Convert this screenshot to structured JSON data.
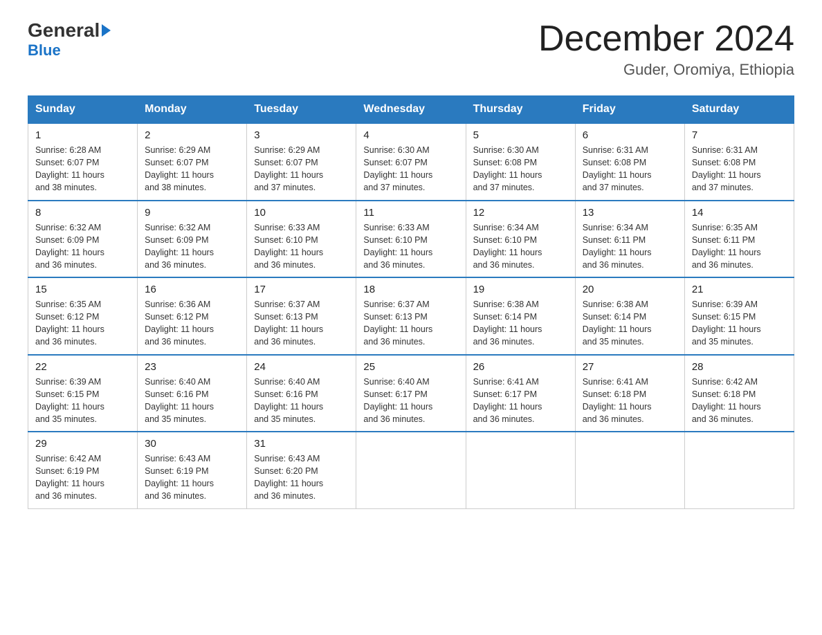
{
  "header": {
    "logo_general": "General",
    "logo_blue": "Blue",
    "month_title": "December 2024",
    "location": "Guder, Oromiya, Ethiopia"
  },
  "days_of_week": [
    "Sunday",
    "Monday",
    "Tuesday",
    "Wednesday",
    "Thursday",
    "Friday",
    "Saturday"
  ],
  "weeks": [
    [
      {
        "day": "1",
        "sunrise": "6:28 AM",
        "sunset": "6:07 PM",
        "daylight": "11 hours and 38 minutes."
      },
      {
        "day": "2",
        "sunrise": "6:29 AM",
        "sunset": "6:07 PM",
        "daylight": "11 hours and 38 minutes."
      },
      {
        "day": "3",
        "sunrise": "6:29 AM",
        "sunset": "6:07 PM",
        "daylight": "11 hours and 37 minutes."
      },
      {
        "day": "4",
        "sunrise": "6:30 AM",
        "sunset": "6:07 PM",
        "daylight": "11 hours and 37 minutes."
      },
      {
        "day": "5",
        "sunrise": "6:30 AM",
        "sunset": "6:08 PM",
        "daylight": "11 hours and 37 minutes."
      },
      {
        "day": "6",
        "sunrise": "6:31 AM",
        "sunset": "6:08 PM",
        "daylight": "11 hours and 37 minutes."
      },
      {
        "day": "7",
        "sunrise": "6:31 AM",
        "sunset": "6:08 PM",
        "daylight": "11 hours and 37 minutes."
      }
    ],
    [
      {
        "day": "8",
        "sunrise": "6:32 AM",
        "sunset": "6:09 PM",
        "daylight": "11 hours and 36 minutes."
      },
      {
        "day": "9",
        "sunrise": "6:32 AM",
        "sunset": "6:09 PM",
        "daylight": "11 hours and 36 minutes."
      },
      {
        "day": "10",
        "sunrise": "6:33 AM",
        "sunset": "6:10 PM",
        "daylight": "11 hours and 36 minutes."
      },
      {
        "day": "11",
        "sunrise": "6:33 AM",
        "sunset": "6:10 PM",
        "daylight": "11 hours and 36 minutes."
      },
      {
        "day": "12",
        "sunrise": "6:34 AM",
        "sunset": "6:10 PM",
        "daylight": "11 hours and 36 minutes."
      },
      {
        "day": "13",
        "sunrise": "6:34 AM",
        "sunset": "6:11 PM",
        "daylight": "11 hours and 36 minutes."
      },
      {
        "day": "14",
        "sunrise": "6:35 AM",
        "sunset": "6:11 PM",
        "daylight": "11 hours and 36 minutes."
      }
    ],
    [
      {
        "day": "15",
        "sunrise": "6:35 AM",
        "sunset": "6:12 PM",
        "daylight": "11 hours and 36 minutes."
      },
      {
        "day": "16",
        "sunrise": "6:36 AM",
        "sunset": "6:12 PM",
        "daylight": "11 hours and 36 minutes."
      },
      {
        "day": "17",
        "sunrise": "6:37 AM",
        "sunset": "6:13 PM",
        "daylight": "11 hours and 36 minutes."
      },
      {
        "day": "18",
        "sunrise": "6:37 AM",
        "sunset": "6:13 PM",
        "daylight": "11 hours and 36 minutes."
      },
      {
        "day": "19",
        "sunrise": "6:38 AM",
        "sunset": "6:14 PM",
        "daylight": "11 hours and 36 minutes."
      },
      {
        "day": "20",
        "sunrise": "6:38 AM",
        "sunset": "6:14 PM",
        "daylight": "11 hours and 35 minutes."
      },
      {
        "day": "21",
        "sunrise": "6:39 AM",
        "sunset": "6:15 PM",
        "daylight": "11 hours and 35 minutes."
      }
    ],
    [
      {
        "day": "22",
        "sunrise": "6:39 AM",
        "sunset": "6:15 PM",
        "daylight": "11 hours and 35 minutes."
      },
      {
        "day": "23",
        "sunrise": "6:40 AM",
        "sunset": "6:16 PM",
        "daylight": "11 hours and 35 minutes."
      },
      {
        "day": "24",
        "sunrise": "6:40 AM",
        "sunset": "6:16 PM",
        "daylight": "11 hours and 35 minutes."
      },
      {
        "day": "25",
        "sunrise": "6:40 AM",
        "sunset": "6:17 PM",
        "daylight": "11 hours and 36 minutes."
      },
      {
        "day": "26",
        "sunrise": "6:41 AM",
        "sunset": "6:17 PM",
        "daylight": "11 hours and 36 minutes."
      },
      {
        "day": "27",
        "sunrise": "6:41 AM",
        "sunset": "6:18 PM",
        "daylight": "11 hours and 36 minutes."
      },
      {
        "day": "28",
        "sunrise": "6:42 AM",
        "sunset": "6:18 PM",
        "daylight": "11 hours and 36 minutes."
      }
    ],
    [
      {
        "day": "29",
        "sunrise": "6:42 AM",
        "sunset": "6:19 PM",
        "daylight": "11 hours and 36 minutes."
      },
      {
        "day": "30",
        "sunrise": "6:43 AM",
        "sunset": "6:19 PM",
        "daylight": "11 hours and 36 minutes."
      },
      {
        "day": "31",
        "sunrise": "6:43 AM",
        "sunset": "6:20 PM",
        "daylight": "11 hours and 36 minutes."
      },
      null,
      null,
      null,
      null
    ]
  ],
  "labels": {
    "sunrise": "Sunrise:",
    "sunset": "Sunset:",
    "daylight": "Daylight:"
  }
}
